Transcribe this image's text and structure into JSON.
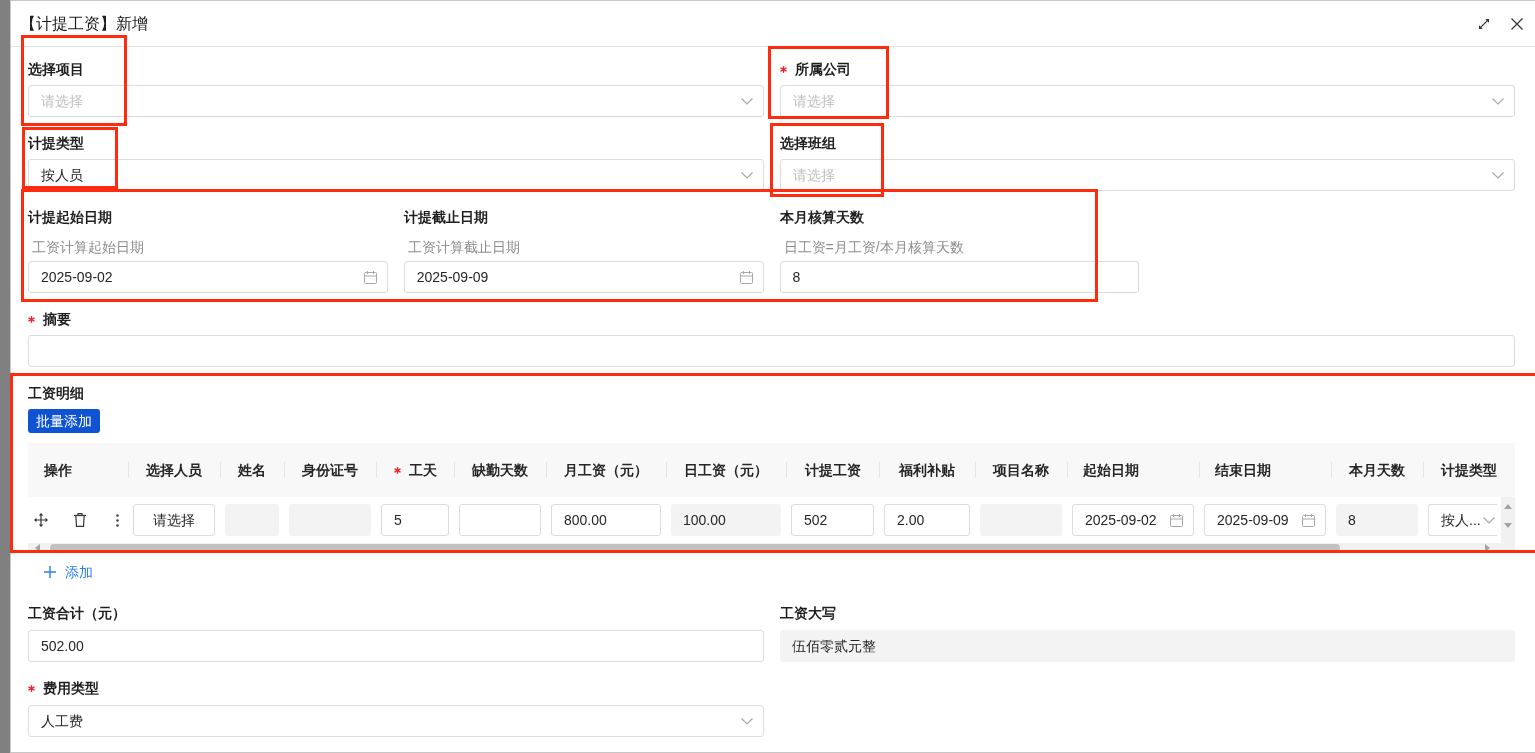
{
  "window": {
    "title": "【计提工资】新增"
  },
  "fields": [
    {
      "label": "选择项目",
      "required": false,
      "highlighted": true,
      "kind": "select",
      "placeholder": "请选择"
    },
    {
      "label": "所属公司",
      "required": true,
      "highlighted": true,
      "kind": "select",
      "placeholder": "请选择"
    },
    {
      "label": "计提类型",
      "required": false,
      "highlighted": true,
      "kind": "select",
      "value": "按人员"
    },
    {
      "label": "选择班组",
      "required": false,
      "highlighted": true,
      "kind": "select",
      "placeholder": "请选择"
    }
  ],
  "period": {
    "highlighted": true,
    "fields": [
      {
        "label": "计提起始日期",
        "hint": "工资计算起始日期",
        "kind": "date",
        "value": "2025-09-02"
      },
      {
        "label": "计提截止日期",
        "hint": "工资计算截止日期",
        "kind": "date",
        "value": "2025-09-09"
      },
      {
        "label": "本月核算天数",
        "hint": "日工资=月工资/本月核算天数",
        "kind": "input",
        "value": "8"
      }
    ]
  },
  "summary": {
    "label": "摘要",
    "required": true,
    "kind": "input"
  },
  "detail": {
    "title": "工资明细",
    "highlighted": true,
    "batch_button": "批量添加",
    "columns": [
      {
        "label": "操作",
        "required": false
      },
      {
        "label": "选择人员",
        "required": false
      },
      {
        "label": "姓名",
        "required": false
      },
      {
        "label": "身份证号",
        "required": false
      },
      {
        "label": "工天",
        "required": true
      },
      {
        "label": "缺勤天数",
        "required": false
      },
      {
        "label": "月工资（元）",
        "required": false
      },
      {
        "label": "日工资（元）",
        "required": false
      },
      {
        "label": "计提工资",
        "required": false
      },
      {
        "label": "福利补贴",
        "required": false
      },
      {
        "label": "项目名称",
        "required": false
      },
      {
        "label": "起始日期",
        "required": false
      },
      {
        "label": "结束日期",
        "required": false
      },
      {
        "label": "本月天数",
        "required": false
      },
      {
        "label": "计提类型",
        "required": false
      }
    ],
    "rows": [
      {
        "cells": [
          {
            "kind": "actions"
          },
          {
            "kind": "button",
            "label": "请选择"
          },
          {
            "kind": "readonly"
          },
          {
            "kind": "readonly"
          },
          {
            "kind": "input",
            "value": "5"
          },
          {
            "kind": "input"
          },
          {
            "kind": "input",
            "value": "800.00"
          },
          {
            "kind": "readonly",
            "value": "100.00"
          },
          {
            "kind": "input",
            "value": "502"
          },
          {
            "kind": "input",
            "value": "2.00"
          },
          {
            "kind": "readonly"
          },
          {
            "kind": "date",
            "value": "2025-09-02"
          },
          {
            "kind": "date",
            "value": "2025-09-09"
          },
          {
            "kind": "readonly",
            "value": "8"
          },
          {
            "kind": "select",
            "value": "按人..."
          }
        ]
      }
    ],
    "add_link": "添加"
  },
  "totals": [
    {
      "label": "工资合计（元）",
      "kind": "input",
      "value": "502.00"
    },
    {
      "label": "工资大写",
      "kind": "readonly",
      "value": "伍佰零贰元整"
    }
  ],
  "expense_type": {
    "label": "费用类型",
    "required": true,
    "kind": "select",
    "value": "人工费"
  }
}
